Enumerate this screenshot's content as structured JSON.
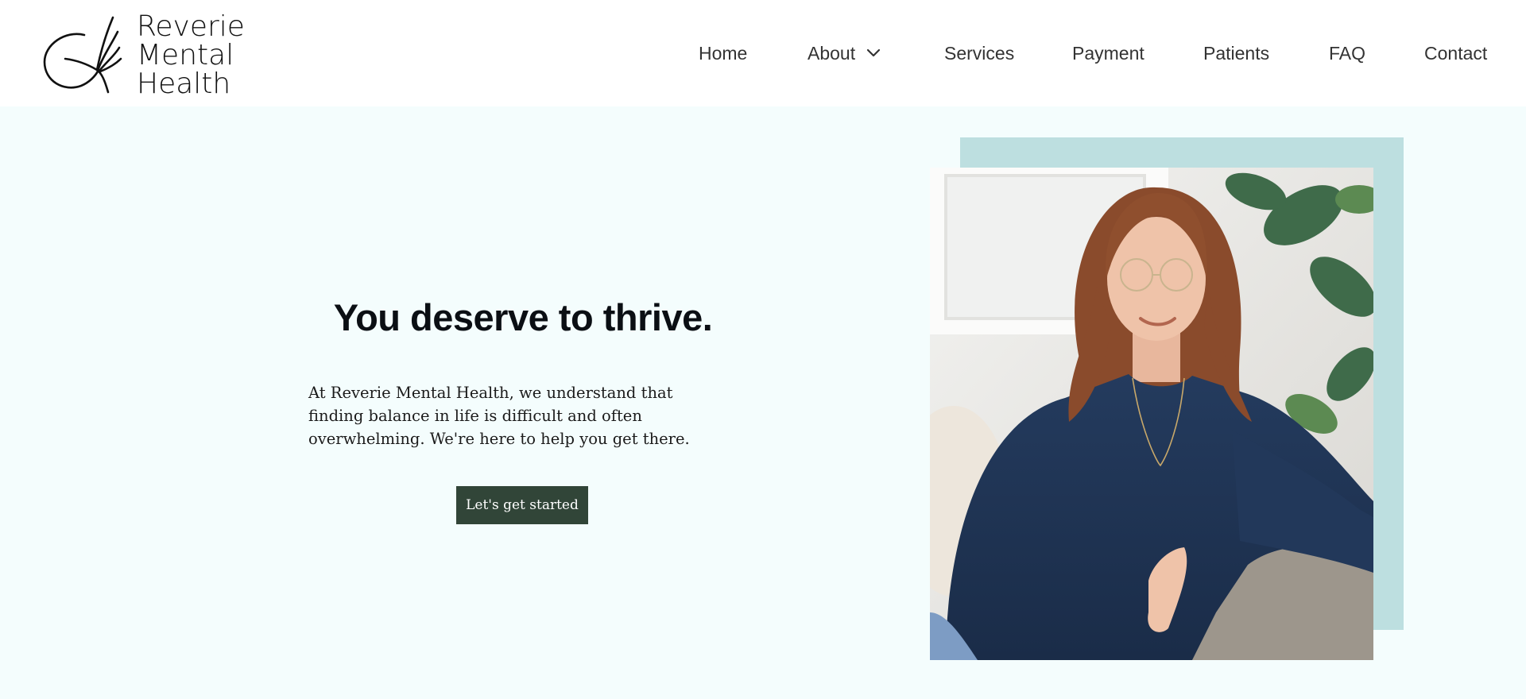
{
  "brand": {
    "name_line1": "Reverie",
    "name_line2": "Mental",
    "name_line3": "Health"
  },
  "nav": {
    "items": [
      {
        "label": "Home"
      },
      {
        "label": "About",
        "has_dropdown": true
      },
      {
        "label": "Services"
      },
      {
        "label": "Payment"
      },
      {
        "label": "Patients"
      },
      {
        "label": "FAQ"
      },
      {
        "label": "Contact"
      }
    ]
  },
  "hero": {
    "title": "You deserve to thrive.",
    "body": "At Reverie Mental Health, we understand that finding balance in life is difficult and often overwhelming. We're here to help you get there.",
    "cta_label": "Let's get started"
  },
  "colors": {
    "hero_background": "#f4fdfd",
    "photo_backdrop": "#bddfe0",
    "cta_background": "#314538"
  },
  "icons": {
    "logo": "dandelion-seed-logo",
    "about_dropdown": "chevron-down-icon"
  }
}
